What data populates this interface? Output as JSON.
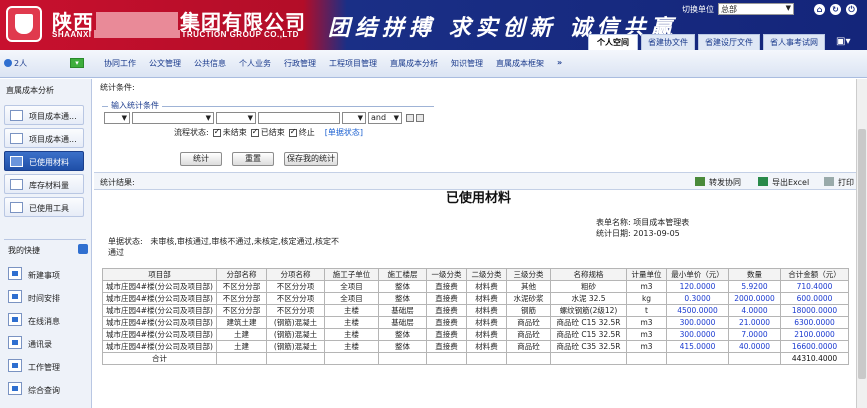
{
  "header": {
    "company_cn_part1": "陕西",
    "company_cn_part2": "集团有限公司",
    "company_en_part1": "SHAANXI",
    "company_en_part2": "TRUCTION GROUP CO.,LTD",
    "slogan": "团结拼搏 求实创新 诚信共赢",
    "unit_label": "切换单位",
    "unit_select": "总部",
    "icons": [
      "home-icon",
      "refresh-icon",
      "power-icon"
    ],
    "tabs": [
      "个人空间",
      "省建协文件",
      "省建设厅文件",
      "省人事考试网"
    ],
    "active_tab": "个人空间"
  },
  "nav": {
    "user_label": "2人",
    "items": [
      "协同工作",
      "公文管理",
      "公共信息",
      "个人业务",
      "行政管理",
      "工程项目管理",
      "直属成本分析",
      "知识管理",
      "直属成本框架"
    ],
    "more": "»"
  },
  "sidebar": {
    "title": "直属成本分析",
    "items": [
      {
        "label": "项目成本通..."
      },
      {
        "label": "项目成本通..."
      },
      {
        "label": "已使用材料"
      },
      {
        "label": "库存材料量"
      },
      {
        "label": "已使用工具"
      }
    ],
    "active_index": 2,
    "quick_title": "我的快捷",
    "quick_items": [
      "新建事项",
      "时间安排",
      "在线消息",
      "通讯录",
      "工作管理",
      "综合查询"
    ]
  },
  "filters": {
    "section_label": "统计条件:",
    "legend": "输入统计条件",
    "logic_select": "and",
    "status_label": "流程状态:",
    "statuses": [
      "未结束",
      "已结束",
      "终止"
    ],
    "doc_status_link": "[单据状态]",
    "buttons": {
      "stat": "统计",
      "reset": "重置",
      "save": "保存我的统计"
    }
  },
  "results": {
    "section_label": "统计结果:",
    "tools": {
      "forward": "转发协同",
      "export": "导出Excel",
      "print": "打印"
    }
  },
  "report": {
    "title": "已使用材料",
    "form_name_label": "表单名称:",
    "form_name": "项目成本管理表",
    "stat_date_label": "统计日期:",
    "stat_date": "2013-09-05",
    "doc_status_label": "单据状态:",
    "doc_status_text": "未审核,审核通过,审核不通过,未核定,核定通过,核定不通过",
    "columns": [
      "项目部",
      "分部名称",
      "分项名称",
      "施工子单位",
      "施工楼层",
      "一级分类",
      "二级分类",
      "三级分类",
      "名称规格",
      "计量单位",
      "最小单价（元）",
      "数量",
      "合计金额（元）"
    ],
    "rows": [
      [
        "城市庄园4#楼(分公司及项目部)",
        "不区分分部",
        "不区分分项",
        "全项目",
        "整体",
        "直接费",
        "材料费",
        "其他",
        "粗砂",
        "m3",
        "120.0000",
        "5.9200",
        "710.4000"
      ],
      [
        "城市庄园4#楼(分公司及项目部)",
        "不区分分部",
        "不区分分项",
        "全项目",
        "整体",
        "直接费",
        "材料费",
        "水泥砂浆",
        "水泥 32.5",
        "kg",
        "0.3000",
        "2000.0000",
        "600.0000"
      ],
      [
        "城市庄园4#楼(分公司及项目部)",
        "不区分分部",
        "不区分分项",
        "主楼",
        "基础层",
        "直接费",
        "材料费",
        "钢筋",
        "螺纹钢筋(2级12)",
        "t",
        "4500.0000",
        "4.0000",
        "18000.0000"
      ],
      [
        "城市庄园4#楼(分公司及项目部)",
        "建筑土建",
        "(钢筋)混凝土",
        "主楼",
        "基础层",
        "直接费",
        "材料费",
        "商品砼",
        "商品砼 C15 32.5R",
        "m3",
        "300.0000",
        "21.0000",
        "6300.0000"
      ],
      [
        "城市庄园4#楼(分公司及项目部)",
        "土建",
        "(钢筋)混凝土",
        "主楼",
        "整体",
        "直接费",
        "材料费",
        "商品砼",
        "商品砼 C15 32.5R",
        "m3",
        "300.0000",
        "7.0000",
        "2100.0000"
      ],
      [
        "城市庄园4#楼(分公司及项目部)",
        "土建",
        "(钢筋)混凝土",
        "主楼",
        "整体",
        "直接费",
        "材料费",
        "商品砼",
        "商品砼 C35 32.5R",
        "m3",
        "415.0000",
        "40.0000",
        "16600.0000"
      ]
    ],
    "total_label": "合计",
    "total_value": "44310.4000"
  }
}
